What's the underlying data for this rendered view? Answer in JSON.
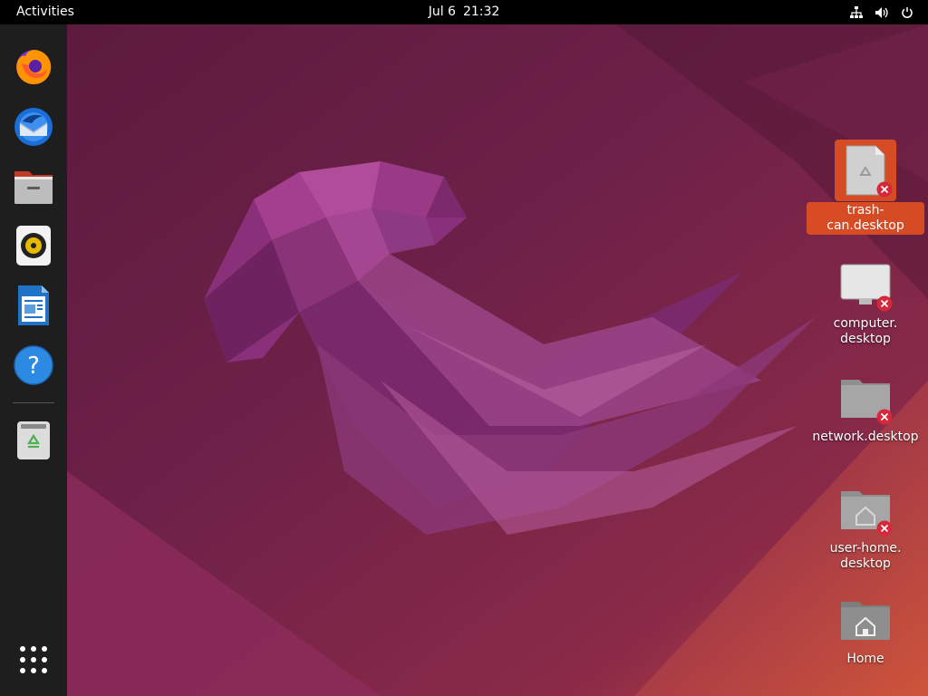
{
  "topbar": {
    "activities": "Activities",
    "date": "Jul 6",
    "time": "21:32"
  },
  "tray": {
    "network_icon": "network-wired-icon",
    "volume_icon": "speaker-icon",
    "power_icon": "power-icon"
  },
  "dock": {
    "items": [
      {
        "app": "Firefox",
        "icon": "firefox-icon"
      },
      {
        "app": "Thunderbird",
        "icon": "thunderbird-icon"
      },
      {
        "app": "Files",
        "icon": "files-icon"
      },
      {
        "app": "Rhythmbox",
        "icon": "rhythmbox-icon"
      },
      {
        "app": "LibreOffice Writer",
        "icon": "libreoffice-writer-icon"
      },
      {
        "app": "Help",
        "icon": "help-icon"
      },
      {
        "app": "Trash",
        "icon": "trash-icon"
      }
    ],
    "show_apps_icon": "app-grid-icon"
  },
  "desktop": {
    "icons": [
      {
        "label": "trash-can.desktop",
        "selected": true,
        "icon": "trash-can-file-icon",
        "broken": true
      },
      {
        "label": "computer.\ndesktop",
        "selected": false,
        "icon": "computer-file-icon",
        "broken": true
      },
      {
        "label": "network.desktop",
        "selected": false,
        "icon": "network-file-icon",
        "broken": true
      },
      {
        "label": "user-home.\ndesktop",
        "selected": false,
        "icon": "user-home-file-icon",
        "broken": true
      },
      {
        "label": "Home",
        "selected": false,
        "icon": "home-folder-icon",
        "broken": false
      }
    ]
  },
  "colors": {
    "accent": "#E95420",
    "topbar": "#000000",
    "dock": "#1E1E1E",
    "badge": "#D6283A"
  }
}
